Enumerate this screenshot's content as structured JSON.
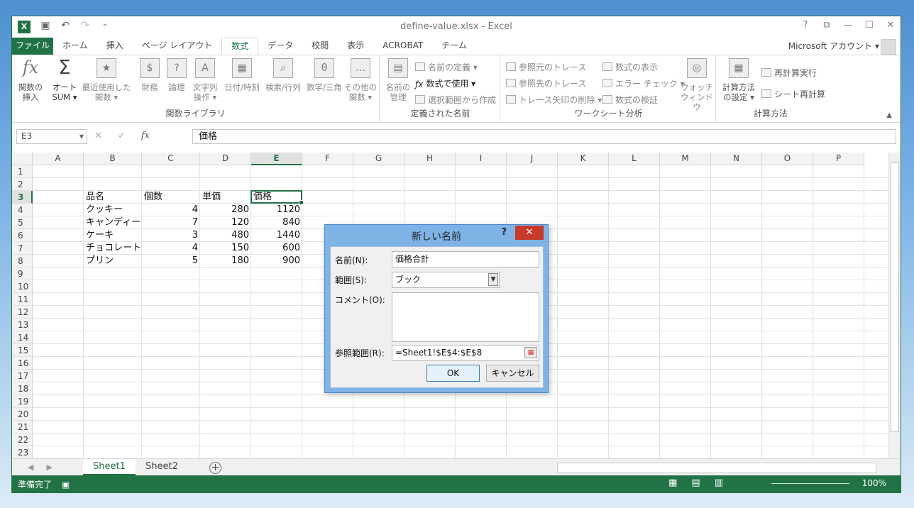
{
  "window": {
    "title": "define-value.xlsx - Excel",
    "controls": [
      "?",
      "⧉",
      "—",
      "☐",
      "✕"
    ]
  },
  "qat": {
    "logo": "X",
    "save": "💾",
    "undo": "↶",
    "redo": "↷",
    "customize": "⌄"
  },
  "tabs": [
    "ファイル",
    "ホーム",
    "挿入",
    "ページ レイアウト",
    "数式",
    "データ",
    "校閲",
    "表示",
    "ACROBAT",
    "チーム"
  ],
  "active_tab": "数式",
  "account": "Microsoft アカウント",
  "ribbon": {
    "func_library": {
      "label": "関数ライブラリ",
      "insert_func_l1": "関数の",
      "insert_func_l2": "挿入",
      "autosum_l1": "オート",
      "autosum_l2": "SUM ▾",
      "recent_l1": "最近使用した",
      "recent_l2": "関数 ▾",
      "financial": "財務",
      "logical": "論理",
      "text_l1": "文字列",
      "text_l2": "操作 ▾",
      "datetime": "日付/時刻",
      "lookup": "検索/行列",
      "math": "数学/三角",
      "more_l1": "その他の",
      "more_l2": "関数 ▾"
    },
    "defined_names": {
      "label": "定義された名前",
      "name_mgr_l1": "名前の",
      "name_mgr_l2": "管理",
      "define_name": "名前の定義 ▾",
      "use_in_formula": "数式で使用 ▾",
      "create_from_sel": "選択範囲から作成"
    },
    "formula_audit": {
      "label": "ワークシート分析",
      "trace_precedents": "参照元のトレース",
      "trace_dependents": "参照先のトレース",
      "remove_arrows": "トレース矢印の削除 ▾",
      "show_formulas": "数式の表示",
      "error_check": "エラー チェック ▾",
      "evaluate": "数式の検証",
      "watch_l1": "ウォッチ",
      "watch_l2": "ウィンドウ"
    },
    "calculation": {
      "label": "計算方法",
      "options_l1": "計算方法",
      "options_l2": "の設定 ▾",
      "calc_now": "再計算実行",
      "calc_sheet": "シート再計算"
    }
  },
  "formula_bar": {
    "name_box": "E3",
    "cancel": "✕",
    "enter": "✓",
    "fx": "fx",
    "value": "価格"
  },
  "columns": [
    "A",
    "B",
    "C",
    "D",
    "E",
    "F",
    "G",
    "H",
    "I",
    "J",
    "K",
    "L",
    "M",
    "N",
    "O",
    "P"
  ],
  "selected_column": "E",
  "rows": [
    "1",
    "2",
    "3",
    "4",
    "5",
    "6",
    "7",
    "8",
    "9",
    "10",
    "11",
    "12",
    "13",
    "14",
    "15",
    "16",
    "17",
    "18",
    "19",
    "20",
    "21",
    "22",
    "23"
  ],
  "selected_row": "3",
  "table": {
    "headers": [
      "品名",
      "個数",
      "単価",
      "価格"
    ],
    "rows": [
      [
        "クッキー",
        "4",
        "280",
        "1120"
      ],
      [
        "キャンディー",
        "7",
        "120",
        "840"
      ],
      [
        "ケーキ",
        "3",
        "480",
        "1440"
      ],
      [
        "チョコレート",
        "4",
        "150",
        "600"
      ],
      [
        "プリン",
        "5",
        "180",
        "900"
      ]
    ]
  },
  "sheets": [
    "Sheet1",
    "Sheet2"
  ],
  "active_sheet": "Sheet1",
  "status": {
    "text": "準備完了",
    "zoom": "100%"
  },
  "dialog": {
    "title": "新しい名前",
    "help": "?",
    "close": "✕",
    "name_label": "名前(N):",
    "name_value": "価格合計",
    "scope_label": "範囲(S):",
    "scope_value": "ブック",
    "comment_label": "コメント(O):",
    "comment_value": "",
    "ref_label": "参照範囲(R):",
    "ref_value": "=Sheet1!$E$4:$E$8",
    "ok": "OK",
    "cancel": "キャンセル"
  }
}
